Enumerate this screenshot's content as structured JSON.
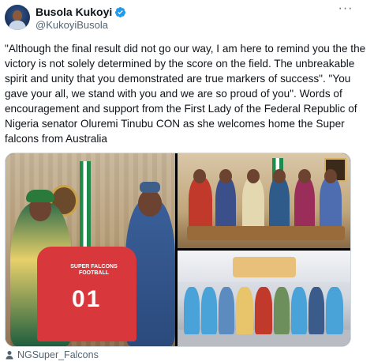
{
  "author": {
    "display_name": "Busola Kukoyi",
    "handle": "@KukoyiBusola",
    "verified": true
  },
  "icons": {
    "verified": "verified-badge-icon",
    "more": "more-options-icon",
    "source": "person-icon"
  },
  "more_label": "···",
  "tweet": {
    "text": "\"Although the final result did not go our way, I am here to remind you the the victory is not solely determined by the score on the field. The unbreakable spirit and unity that you demonstrated are true markers of success\". \"You gave your all, we stand with you and we are so proud of you\". Words of encouragement and support from the First Lady of the Federal Republic of Nigeria senator Oluremi Tinubu CON as she welcomes home the Super falcons from Australia"
  },
  "media": {
    "jersey_title": "SUPER FALCONS FOOTBALL",
    "jersey_number": "01"
  },
  "source": {
    "label": "NGSuper_Falcons"
  },
  "colors": {
    "verified_blue": "#1d9bf0",
    "secondary_text": "#536471",
    "jersey_red": "#d8383c"
  }
}
